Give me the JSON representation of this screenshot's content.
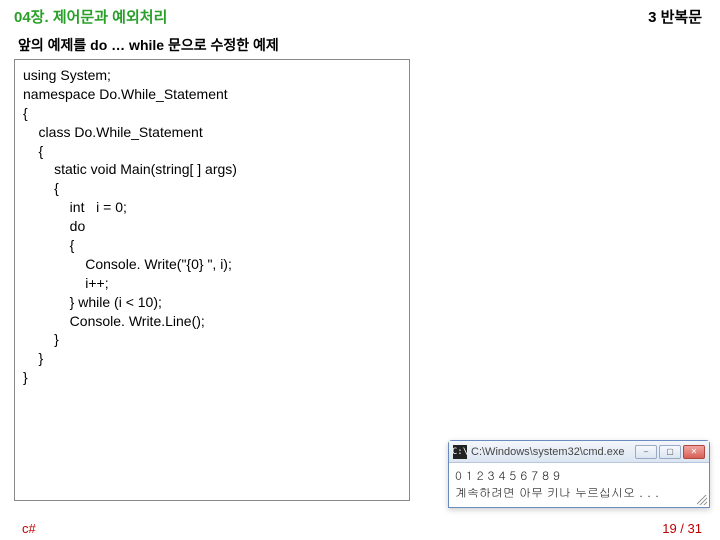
{
  "header": {
    "left": "04장. 제어문과 예외처리",
    "right": "3 반복문"
  },
  "subtitle": "앞의 예제를 do … while 문으로 수정한 예제",
  "code": {
    "l1": "using System;",
    "l2": "",
    "l3": "namespace Do.While_Statement",
    "l4": "{",
    "l5": "    class Do.While_Statement",
    "l6": "    {",
    "l7": "        static void Main(string[ ] args)",
    "l8": "        {",
    "l9": "            int   i = 0;",
    "l10": "",
    "l11": "            do",
    "l12": "            {",
    "l13": "                Console. Write(\"{0} \", i);",
    "l14": "                i++;",
    "l15": "            } while (i < 10);",
    "l16": "",
    "l17": "            Console. Write.Line();",
    "l18": "        }",
    "l19": "    }",
    "l20": "}"
  },
  "console": {
    "icon_glyph": "C:\\",
    "title": "C:\\Windows\\system32\\cmd.exe",
    "output_line1": "0 1 2 3 4 5 6 7 8 9",
    "output_line2": "계속하려면 아무 키나 누르십시오 . . .",
    "min_glyph": "–",
    "max_glyph": "▢",
    "close_glyph": "✕"
  },
  "footer": {
    "left": "c#",
    "right": "19 / 31"
  }
}
